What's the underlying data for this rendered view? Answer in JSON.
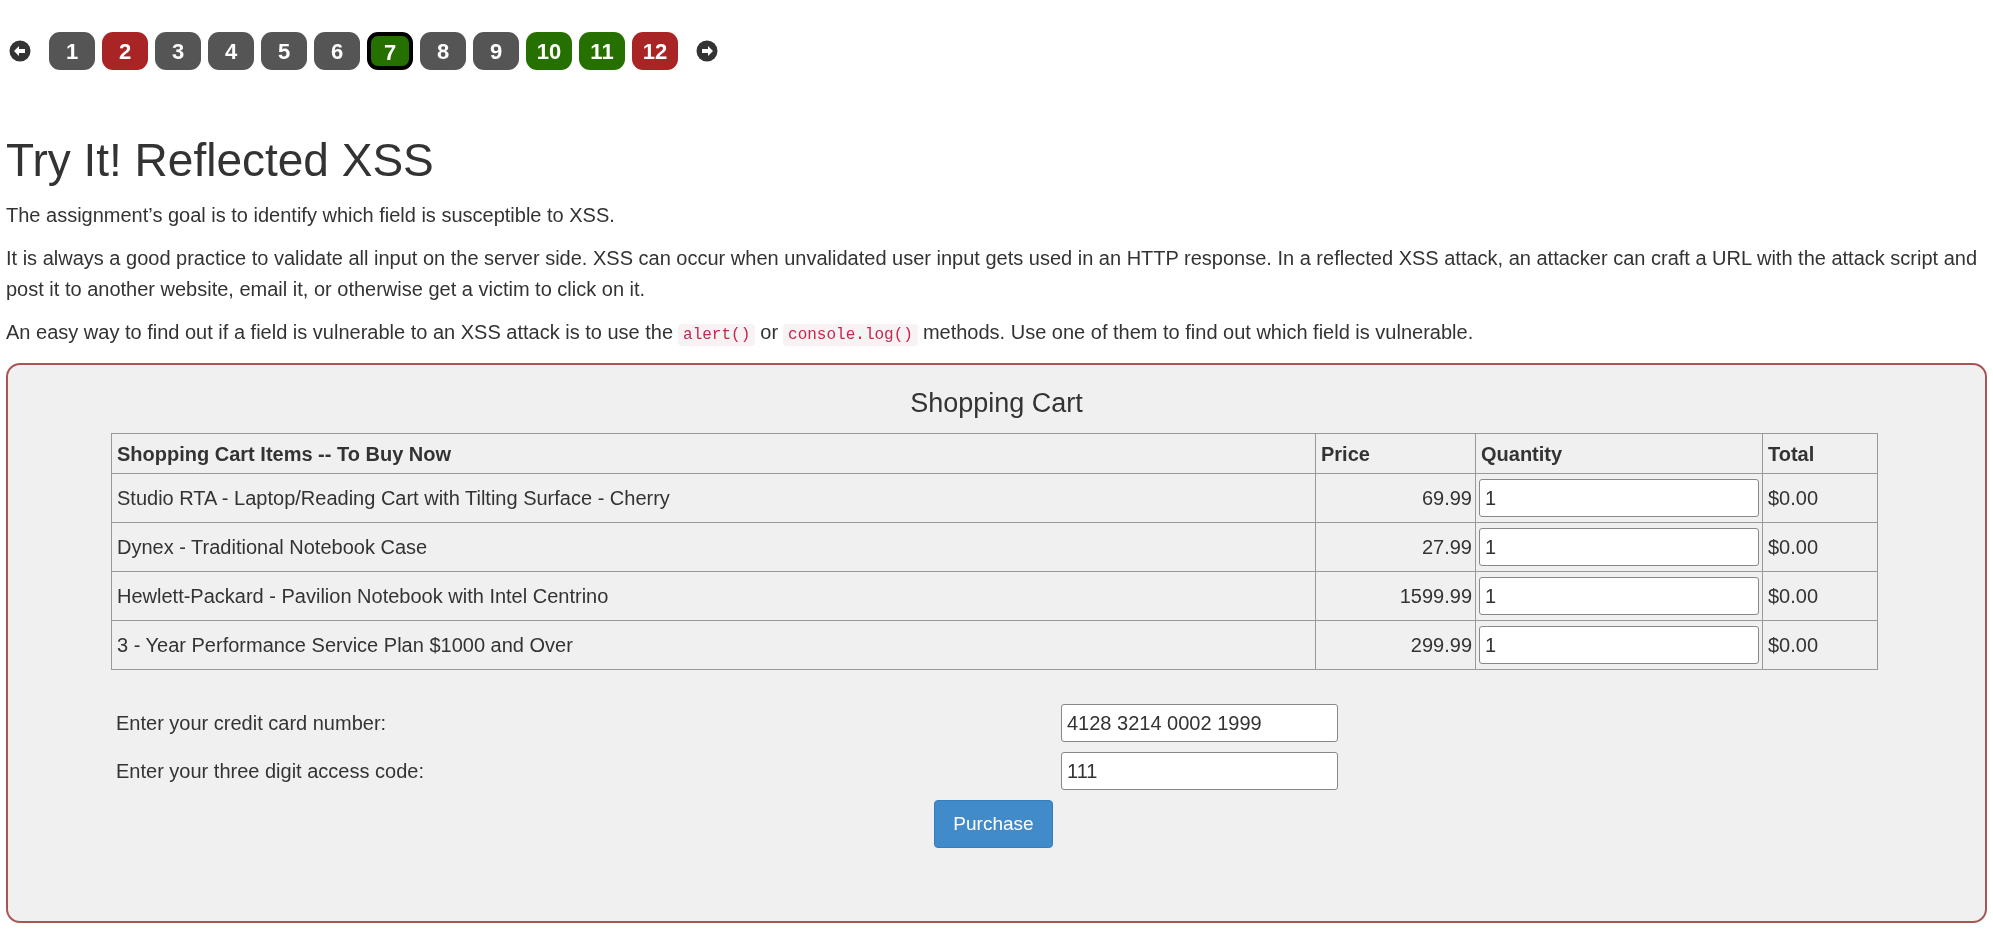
{
  "pagination": {
    "pages": [
      {
        "label": "1",
        "color": "#555555",
        "selected": false
      },
      {
        "label": "2",
        "color": "#a92525",
        "selected": false
      },
      {
        "label": "3",
        "color": "#555555",
        "selected": false
      },
      {
        "label": "4",
        "color": "#555555",
        "selected": false
      },
      {
        "label": "5",
        "color": "#555555",
        "selected": false
      },
      {
        "label": "6",
        "color": "#555555",
        "selected": false
      },
      {
        "label": "7",
        "color": "#267000",
        "selected": true
      },
      {
        "label": "8",
        "color": "#555555",
        "selected": false
      },
      {
        "label": "9",
        "color": "#555555",
        "selected": false
      },
      {
        "label": "10",
        "color": "#267000",
        "selected": false
      },
      {
        "label": "11",
        "color": "#267000",
        "selected": false
      },
      {
        "label": "12",
        "color": "#a92525",
        "selected": false
      }
    ]
  },
  "heading": "Try It! Reflected XSS",
  "paragraphs": [
    [
      {
        "kind": "text",
        "text": "The assignment’s goal is to identify which field is susceptible to XSS."
      }
    ],
    [
      {
        "kind": "text",
        "text": "It is always a good practice to validate all input on the server side. XSS can occur when unvalidated user input gets used in an HTTP response. In a reflected XSS attack, an attacker can craft a URL with the attack script and post it to another website, email it, or otherwise get a victim to click on it."
      }
    ],
    [
      {
        "kind": "text",
        "text": "An easy way to find out if a field is vulnerable to an XSS attack is to use the"
      },
      {
        "kind": "code",
        "text": "alert()"
      },
      {
        "kind": "text",
        "text": "or"
      },
      {
        "kind": "code",
        "text": "console.log()"
      },
      {
        "kind": "text",
        "text": "methods. Use one of them to find out which field is vulnerable."
      }
    ]
  ],
  "cart": {
    "title": "Shopping Cart",
    "columns": [
      "Shopping Cart Items -- To Buy Now",
      "Price",
      "Quantity",
      "Total"
    ],
    "rows": [
      {
        "item": "Studio RTA - Laptop/Reading Cart with Tilting Surface - Cherry",
        "price": "69.99",
        "quantity": "1",
        "total": "$0.00"
      },
      {
        "item": "Dynex - Traditional Notebook Case",
        "price": "27.99",
        "quantity": "1",
        "total": "$0.00"
      },
      {
        "item": "Hewlett-Packard - Pavilion Notebook with Intel Centrino",
        "price": "1599.99",
        "quantity": "1",
        "total": "$0.00"
      },
      {
        "item": "3 - Year Performance Service Plan $1000 and Over",
        "price": "299.99",
        "quantity": "1",
        "total": "$0.00"
      }
    ],
    "fields": [
      {
        "label": "Enter your credit card number:",
        "value": "4128 3214 0002 1999"
      },
      {
        "label": "Enter your three digit access code:",
        "value": "111"
      }
    ],
    "button": "Purchase"
  }
}
